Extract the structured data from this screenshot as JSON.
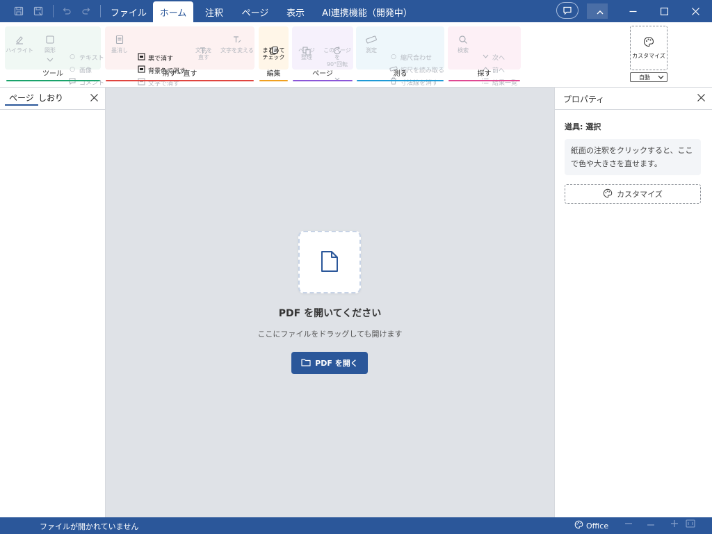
{
  "titlebar": {
    "quick_icons": [
      "save-icon",
      "save-as-icon",
      "undo-icon",
      "redo-icon"
    ],
    "tabs": [
      {
        "label": "ファイル",
        "active": false
      },
      {
        "label": "ホーム",
        "active": true
      },
      {
        "label": "注釈",
        "active": false
      },
      {
        "label": "ページ",
        "active": false
      },
      {
        "label": "表示",
        "active": false
      },
      {
        "label": "AI連携機能（開発中）",
        "active": false
      }
    ],
    "window_buttons": [
      "minimize",
      "maximize",
      "close"
    ]
  },
  "ribbon": {
    "groups": [
      {
        "label": "ツール",
        "color": "#1aa36b",
        "buttons": [
          {
            "label": "ハイライト",
            "icon": "highlighter-icon"
          },
          {
            "label": "図形",
            "icon": "rectangle-icon"
          }
        ],
        "small": [
          {
            "label": "テキスト",
            "icon": "circle-icon"
          },
          {
            "label": "画像",
            "icon": "circle-icon"
          },
          {
            "label": "コメント",
            "icon": "comment-icon"
          }
        ]
      },
      {
        "label": "消す・直す",
        "color": "#e0443e",
        "buttons": [
          {
            "label": "墨消し",
            "icon": "redact-icon"
          },
          {
            "label": "文字を\n直す",
            "icon": "text-edit-icon"
          },
          {
            "label": "文字を変える",
            "icon": "text-replace-icon"
          }
        ],
        "small": [
          {
            "label": "黒で消す",
            "icon": "black-box-icon",
            "enabled": true
          },
          {
            "label": "背景色で消す",
            "icon": "bg-box-icon",
            "enabled": true
          },
          {
            "label": "文字で消す",
            "icon": "text-box-icon",
            "enabled": false
          }
        ]
      },
      {
        "label": "編集",
        "color": "#f0a020",
        "buttons": [
          {
            "label": "まとめて\nチェック",
            "icon": "batch-check-icon"
          }
        ]
      },
      {
        "label": "ページ",
        "color": "#8a55d8",
        "buttons": [
          {
            "label": "ページ\n整理",
            "icon": "pages-icon"
          },
          {
            "label": "このページを\n90°回転",
            "icon": "rotate-icon"
          }
        ]
      },
      {
        "label": "測る",
        "color": "#1e9ad6",
        "buttons": [
          {
            "label": "測定",
            "icon": "ruler-icon"
          }
        ],
        "small": [
          {
            "label": "縮尺合わせ",
            "icon": "circle-icon"
          },
          {
            "label": "縮尺を読み取る",
            "icon": "ruler-small-icon"
          },
          {
            "label": "寸法線を消す",
            "icon": "trash-icon"
          }
        ]
      },
      {
        "label": "探す",
        "color": "#e04892",
        "buttons": [
          {
            "label": "検索",
            "icon": "search-icon"
          }
        ],
        "small": [
          {
            "label": "次へ",
            "icon": "chevron-down-icon"
          },
          {
            "label": "前へ",
            "icon": "chevron-up-icon"
          },
          {
            "label": "結果一覧",
            "icon": "list-icon"
          }
        ]
      }
    ],
    "customize_label": "カスタマイズ",
    "auto_label": "自動"
  },
  "left_panel": {
    "tabs": [
      {
        "label": "ページ",
        "active": true
      },
      {
        "label": "しおり",
        "active": false
      }
    ]
  },
  "main": {
    "empty_title": "PDF を開いてください",
    "empty_subtitle": "ここにファイルをドラッグしても開けます",
    "open_button": "PDF を開く"
  },
  "right_panel": {
    "title": "プロパティ",
    "tool_label": "道具: 選択",
    "hint": "紙面の注釈をクリックすると、ここで色や大きさを直せます。",
    "customize_button": "カスタマイズ"
  },
  "statusbar": {
    "status_text": "ファイルが開かれていません",
    "theme_label": "Office"
  },
  "colors": {
    "accent": "#2b579a",
    "canvas": "#dfe2e7"
  }
}
